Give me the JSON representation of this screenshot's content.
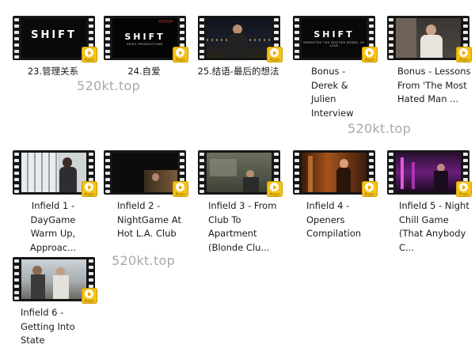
{
  "files": [
    {
      "label": "23.管理关系",
      "badge_text": "Player"
    },
    {
      "label": "24.自爱",
      "badge_text": "Player",
      "frame_top_text": "PICKUP"
    },
    {
      "label": "25.结语-最后的想法",
      "badge_text": "Player"
    },
    {
      "label": "Bonus - Derek & Julien Interview",
      "badge_text": "Player"
    },
    {
      "label": "Bonus - Lessons From 'The Most Hated Man ...",
      "badge_text": "Player"
    },
    {
      "label": "Infield 1 - DayGame Warm Up, Approac...",
      "badge_text": "Player"
    },
    {
      "label": "Infield 2 - NightGame At Hot L.A. Club",
      "badge_text": "Player"
    },
    {
      "label": "Infield 3 - From Club To Apartment (Blonde Clu...",
      "badge_text": "Player"
    },
    {
      "label": "Infield 4 - Openers Compilation",
      "badge_text": "Player"
    },
    {
      "label": "Infield 5 - Night Chill Game (That Anybody C...",
      "badge_text": "Player"
    },
    {
      "label": "Infield 6 - Getting Into State",
      "badge_text": "Player"
    }
  ],
  "frame_titles": {
    "shift": "SHIFT",
    "shift_sub": "ARIES PRODUCTIONS",
    "bonus_sub": "REMASTER THE SHIFTED MODEL OF LOVE"
  },
  "watermarks": [
    "520kt.top",
    "520kt.top",
    "520kt.top"
  ]
}
